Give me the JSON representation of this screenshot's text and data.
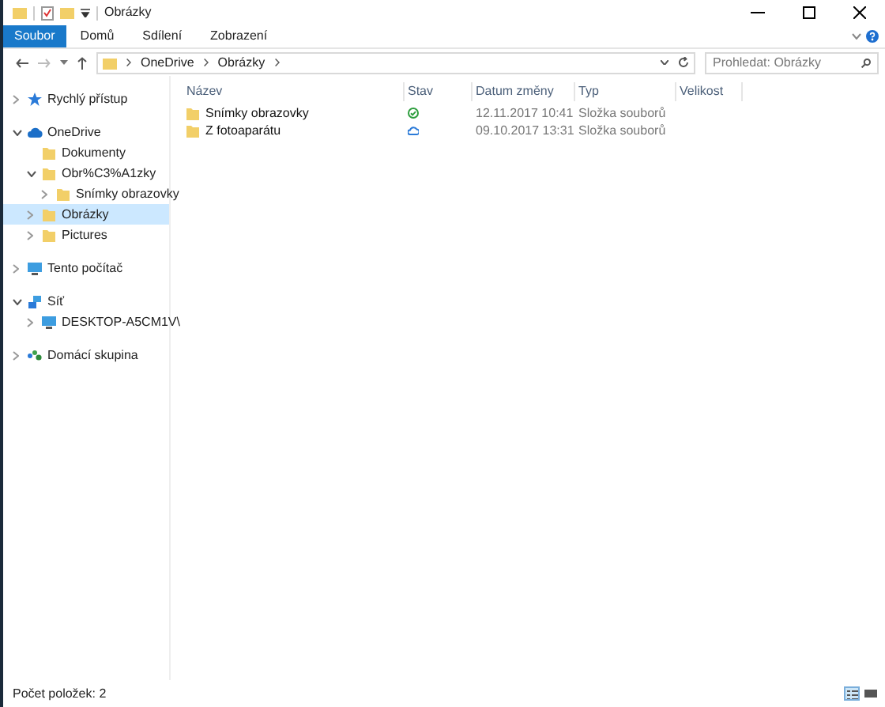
{
  "window": {
    "title": "Obrázky"
  },
  "ribbon_tabs": [
    {
      "label": "Soubor",
      "selected": true
    },
    {
      "label": "Domů",
      "selected": false
    },
    {
      "label": "Sdílení",
      "selected": false
    },
    {
      "label": "Zobrazení",
      "selected": false
    }
  ],
  "address_bar": {
    "path": [
      "OneDrive",
      "Obrázky"
    ]
  },
  "search": {
    "placeholder": "Prohledat: Obrázky"
  },
  "sidebar": {
    "items": [
      {
        "label": "Rychlý přístup",
        "kind": "star",
        "expanded": false,
        "selected": false
      },
      {
        "label": "OneDrive",
        "kind": "cloud",
        "expanded": true,
        "selected": false,
        "children": [
          {
            "label": "Dokumenty",
            "kind": "folder",
            "selected": false
          },
          {
            "label": "Obr%C3%A1zky",
            "kind": "folder",
            "expanded": true,
            "selected": false,
            "children": [
              {
                "label": "Snímky obrazovky",
                "kind": "folder",
                "expanded": false,
                "selected": false
              }
            ]
          },
          {
            "label": "Obrázky",
            "kind": "folder",
            "expanded": false,
            "selected": true
          },
          {
            "label": "Pictures",
            "kind": "folder",
            "expanded": false,
            "selected": false
          }
        ]
      },
      {
        "label": "Tento počítač",
        "kind": "computer",
        "expanded": false,
        "selected": false
      },
      {
        "label": "Síť",
        "kind": "network",
        "expanded": true,
        "selected": false,
        "children": [
          {
            "label": "DESKTOP-A5CM1V\\",
            "kind": "computer",
            "expanded": false,
            "selected": false
          }
        ]
      },
      {
        "label": "Domácí skupina",
        "kind": "homegroup",
        "expanded": false,
        "selected": false
      }
    ]
  },
  "table": {
    "columns": [
      "Název",
      "Stav",
      "Datum změny",
      "Typ",
      "Velikost"
    ],
    "rows": [
      {
        "name": "Snímky obrazovky",
        "kind": "synced",
        "date": "12.11.2017 10:41",
        "type": "Složka souborů"
      },
      {
        "name": "Z fotoaparátu",
        "kind": "cloud",
        "date": "09.10.2017 13:31",
        "type": "Složka souborů"
      }
    ]
  },
  "status_bar": {
    "text": "Počet položek: 2"
  }
}
